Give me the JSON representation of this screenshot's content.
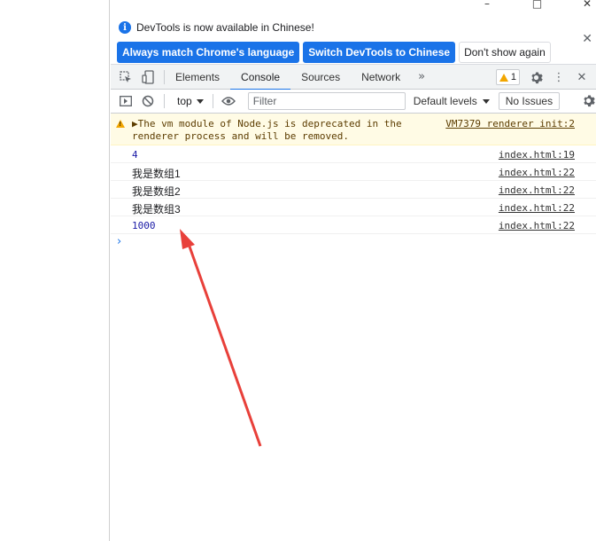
{
  "infobar": {
    "message": "DevTools is now available in Chinese!",
    "buttons": {
      "match": "Always match Chrome's language",
      "switch": "Switch DevTools to Chinese",
      "dismiss": "Don't show again"
    },
    "close_icon": "close-icon"
  },
  "tabs": [
    {
      "label": "Elements",
      "active": false
    },
    {
      "label": "Console",
      "active": true
    },
    {
      "label": "Sources",
      "active": false
    },
    {
      "label": "Network",
      "active": false
    }
  ],
  "tabs_more_icon": "chevron-double-right-icon",
  "warning_badge": {
    "count": "1"
  },
  "toolbar": {
    "context": "top",
    "filter_placeholder": "Filter",
    "levels_label": "Default levels",
    "issues_label": "No Issues"
  },
  "console": {
    "warning": {
      "text": "▶The vm module of Node.js is deprecated in the renderer process and will be removed.",
      "source": "VM7379 renderer init:2"
    },
    "messages": [
      {
        "value": "4",
        "kind": "number",
        "source": "index.html:19"
      },
      {
        "value": "我是数组1",
        "kind": "string",
        "source": "index.html:22"
      },
      {
        "value": "我是数组2",
        "kind": "string",
        "source": "index.html:22"
      },
      {
        "value": "我是数组3",
        "kind": "string",
        "source": "index.html:22"
      },
      {
        "value": "1000",
        "kind": "number",
        "source": "index.html:22"
      }
    ]
  },
  "colors": {
    "accent": "#1a73e8",
    "warning_bg": "#fffbe5",
    "number_blue": "#1a1aa6",
    "annotation_red": "#e8403a"
  }
}
